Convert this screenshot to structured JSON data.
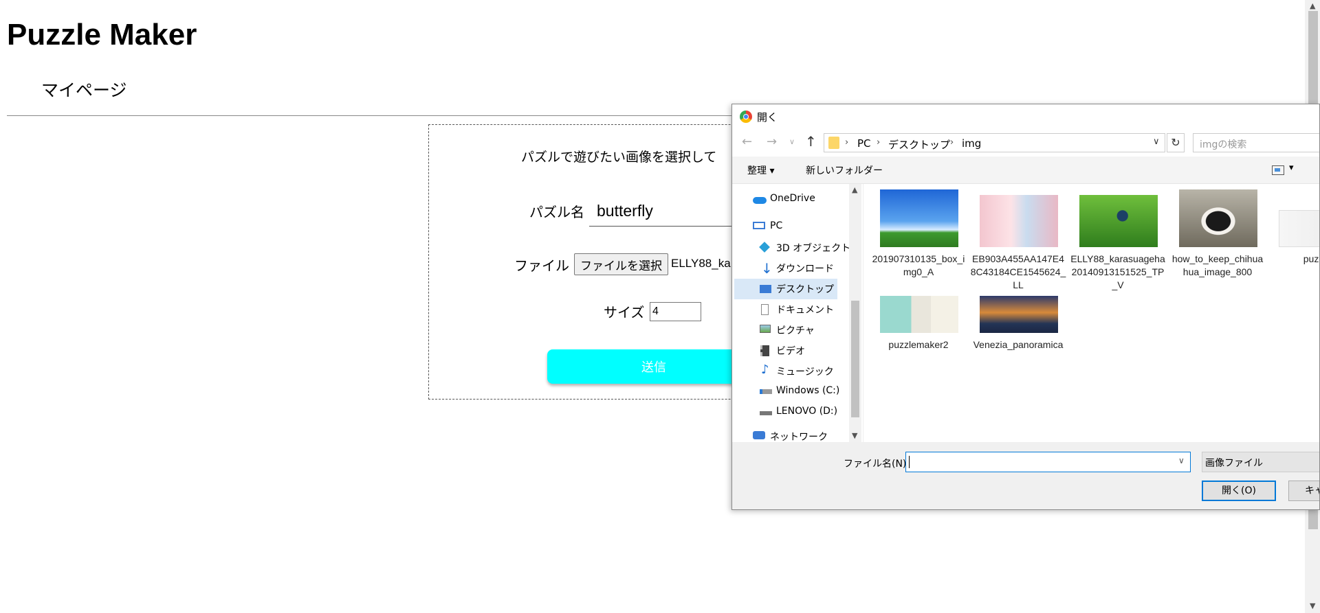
{
  "app": {
    "title": "Puzzle Maker",
    "nav_mypage": "マイページ"
  },
  "form": {
    "instruction": "パズルで遊びたい画像を選択して",
    "name_label": "パズル名",
    "name_value": "butterfly",
    "file_label": "ファイル",
    "file_button": "ファイルを選択",
    "file_chosen": "ELLY88_ka",
    "size_label": "サイズ",
    "size_value": "4",
    "submit": "送信",
    "submit_color": "#00ffff"
  },
  "dialog": {
    "title": "開く",
    "breadcrumb": [
      "PC",
      "デスクトップ",
      "img"
    ],
    "search_placeholder": "imgの検索",
    "toolbar": {
      "organize": "整理 ▾",
      "new_folder": "新しいフォルダー"
    },
    "sidebar": [
      {
        "label": "OneDrive",
        "icon": "cloud-icon"
      },
      {
        "label": "PC",
        "icon": "pc-icon"
      },
      {
        "label": "3D オブジェクト",
        "icon": "3d-objects-icon"
      },
      {
        "label": "ダウンロード",
        "icon": "download-icon"
      },
      {
        "label": "デスクトップ",
        "icon": "desktop-icon",
        "selected": true
      },
      {
        "label": "ドキュメント",
        "icon": "document-icon"
      },
      {
        "label": "ピクチャ",
        "icon": "pictures-icon"
      },
      {
        "label": "ビデオ",
        "icon": "video-icon"
      },
      {
        "label": "ミュージック",
        "icon": "music-icon"
      },
      {
        "label": "Windows (C:)",
        "icon": "drive-c-icon"
      },
      {
        "label": "LENOVO (D:)",
        "icon": "drive-d-icon"
      },
      {
        "label": "ネットワーク",
        "icon": "network-icon"
      }
    ],
    "files": [
      {
        "name": "201907310135_box_img0_A"
      },
      {
        "name": "EB903A455AA147E48C43184CE1545624_LL"
      },
      {
        "name": "ELLY88_karasuageha20140913151525_TP_V"
      },
      {
        "name": "how_to_keep_chihuahua_image_800"
      },
      {
        "name": "puzzle"
      },
      {
        "name": "puzzlemaker2"
      },
      {
        "name": "Venezia_panoramica"
      }
    ],
    "filename_label": "ファイル名(N):",
    "filename_value": "",
    "filetype": "画像ファイル",
    "open_button": "開く(O)",
    "cancel_button": "キャ"
  }
}
